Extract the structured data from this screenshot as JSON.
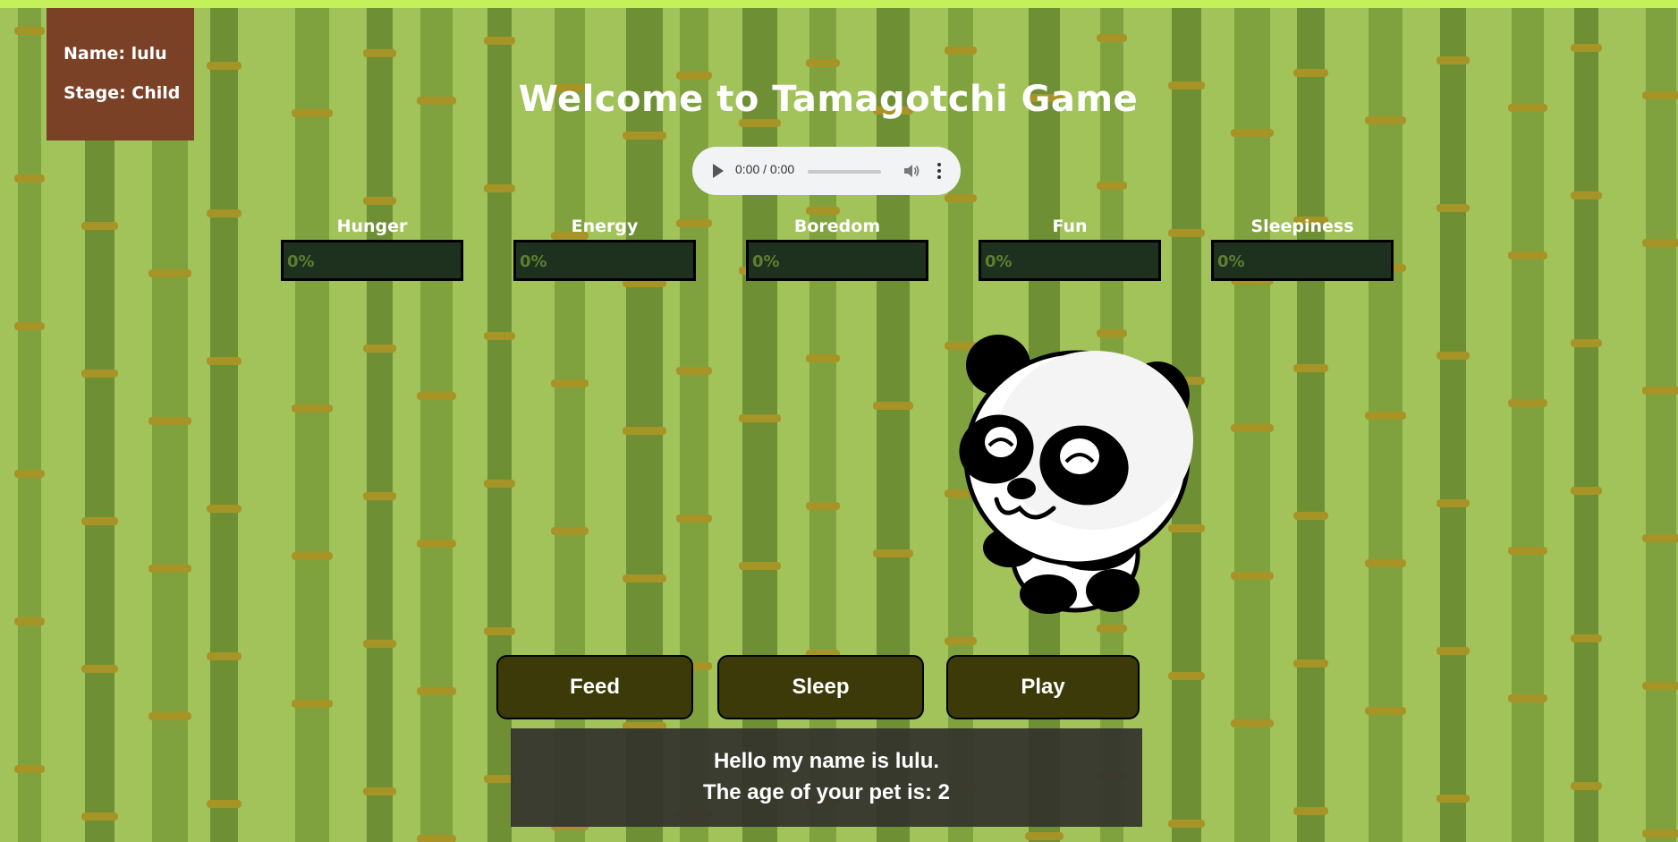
{
  "pet": {
    "name_label": "Name: lulu",
    "stage_label": "Stage: Child"
  },
  "title": "Welcome to Tamagotchi Game",
  "audio": {
    "time": "0:00 / 0:00",
    "icons": [
      "play-icon",
      "volume-icon",
      "more-vert-icon"
    ]
  },
  "stats": [
    {
      "label": "Hunger",
      "value_text": "0%",
      "value": 0
    },
    {
      "label": "Energy",
      "value_text": "0%",
      "value": 0
    },
    {
      "label": "Boredom",
      "value_text": "0%",
      "value": 0
    },
    {
      "label": "Fun",
      "value_text": "0%",
      "value": 0
    },
    {
      "label": "Sleepiness",
      "value_text": "0%",
      "value": 0
    }
  ],
  "actions": {
    "feed": "Feed",
    "sleep": "Sleep",
    "play": "Play"
  },
  "message": {
    "line1": "Hello my name is lulu.",
    "line2": "The age of your pet is: 2"
  },
  "colors": {
    "background": "#a2c25a",
    "info_box": "#7a4127",
    "stat_bar": "#1e311e",
    "button": "#3b3a08"
  }
}
